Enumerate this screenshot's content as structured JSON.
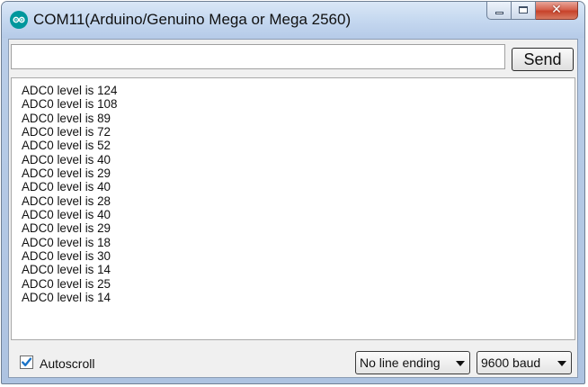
{
  "window": {
    "title": "COM11(Arduino/Genuino Mega or Mega 2560)",
    "icon": "arduino-logo-icon",
    "controls": [
      "minimize-icon",
      "maximize-icon",
      "close-icon"
    ]
  },
  "input": {
    "value": "",
    "placeholder": ""
  },
  "send": {
    "label": "Send"
  },
  "console": {
    "lines": [
      "ADC0 level is 124",
      "ADC0 level is 108",
      "ADC0 level is 89",
      "ADC0 level is 72",
      "ADC0 level is 52",
      "ADC0 level is 40",
      "ADC0 level is 29",
      "ADC0 level is 40",
      "ADC0 level is 28",
      "ADC0 level is 40",
      "ADC0 level is 29",
      "ADC0 level is 18",
      "ADC0 level is 30",
      "ADC0 level is 14",
      "ADC0 level is 25",
      "ADC0 level is 14"
    ]
  },
  "footer": {
    "autoscroll": {
      "label": "Autoscroll",
      "checked": true
    },
    "line_ending": {
      "selected": "No line ending"
    },
    "baud": {
      "selected": "9600 baud"
    }
  },
  "colors": {
    "accent_check": "#1a73c7",
    "arduino_teal": "#00979c"
  }
}
